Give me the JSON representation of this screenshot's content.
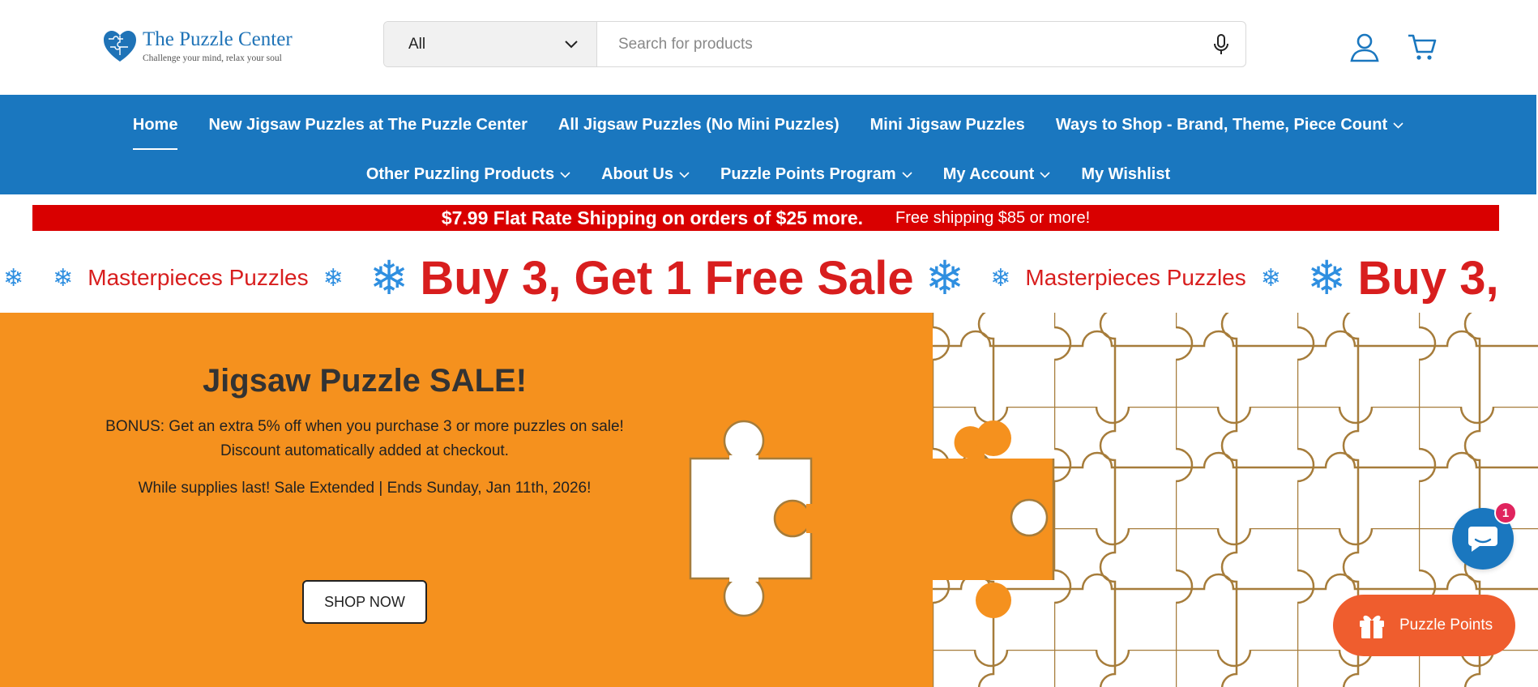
{
  "brand": {
    "title": "The Puzzle Center",
    "tagline": "Challenge your mind, relax your soul",
    "accent": "#1a77bf"
  },
  "search": {
    "category": "All",
    "placeholder": "Search for products"
  },
  "header_icons": [
    "user-icon",
    "cart-icon",
    "mic-icon",
    "chevron-down-icon"
  ],
  "nav": {
    "row1": [
      {
        "label": "Home",
        "dropdown": false,
        "active": true
      },
      {
        "label": "New Jigsaw Puzzles at The Puzzle Center",
        "dropdown": false
      },
      {
        "label": "All Jigsaw Puzzles (No Mini Puzzles)",
        "dropdown": false
      },
      {
        "label": "Mini Jigsaw Puzzles",
        "dropdown": false
      },
      {
        "label": "Ways to Shop - Brand, Theme, Piece Count",
        "dropdown": true
      }
    ],
    "row2": [
      {
        "label": "Other Puzzling Products",
        "dropdown": true
      },
      {
        "label": "About Us",
        "dropdown": true
      },
      {
        "label": "Puzzle Points Program",
        "dropdown": true
      },
      {
        "label": "My Account",
        "dropdown": true
      },
      {
        "label": "My Wishlist",
        "dropdown": false
      }
    ]
  },
  "shipping": {
    "main": "$7.99 Flat Rate Shipping on orders of $25 more.",
    "secondary": "Free shipping $85 or more!",
    "color": "#d90000"
  },
  "marquee": {
    "small": "Masterpieces Puzzles",
    "big": "Buy 3, Get 1 Free Sale",
    "big_clipped": "Buy 3,",
    "flake": "❄"
  },
  "hero": {
    "title": "Jigsaw Puzzle SALE!",
    "bonus_label": "BONUS",
    "bonus_text": ": Get an extra 5% off when you purchase 3 or more puzzles on sale! Discount automatically added at checkout.",
    "ends": "While supplies last! Sale Extended | Ends Sunday, Jan 11th, 2026!",
    "cta": "SHOP NOW",
    "background": "#f5911e"
  },
  "chat": {
    "badge": "1"
  },
  "points": {
    "label": "Puzzle Points"
  }
}
